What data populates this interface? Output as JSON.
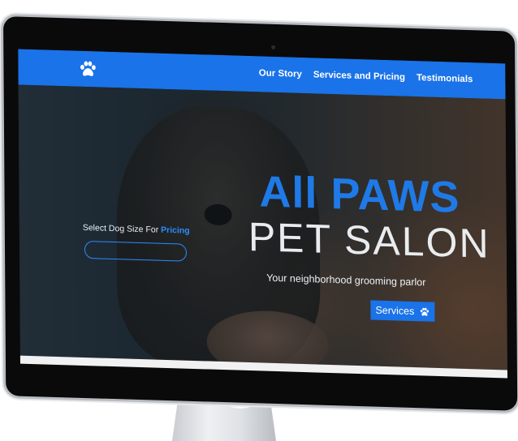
{
  "nav": {
    "logo_icon": "paw-icon",
    "links": [
      "Our Story",
      "Services and Pricing",
      "Testimonials"
    ]
  },
  "hero": {
    "select_prefix": "Select Dog Size For ",
    "select_accent": "Pricing",
    "title_top": "All PAWS",
    "title_bottom": "PET SALON",
    "tagline": "Your neighborhood grooming parlor",
    "cta_label": "Services",
    "cta_icon": "paw-icon"
  },
  "colors": {
    "accent": "#1a73e8",
    "title_blue": "#1f7ae8",
    "bezel": "#0a0a0b"
  }
}
